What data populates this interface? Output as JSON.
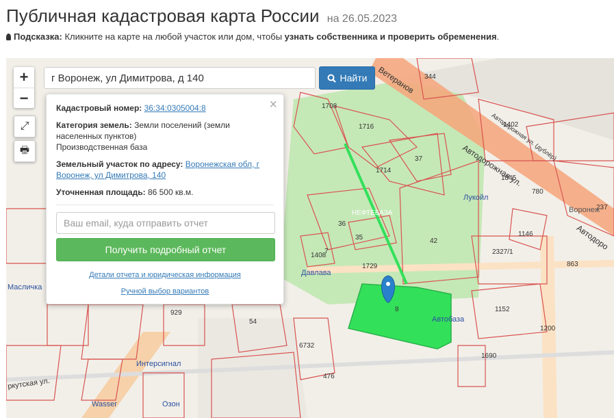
{
  "header": {
    "title": "Публичная кадастровая карта России",
    "date": "на 26.05.2023"
  },
  "hint": {
    "label": "Подсказка:",
    "text": " Кликните на карте на любой участок или дом, чтобы ",
    "bold": "узнать собственника и проверить обременения",
    "end": "."
  },
  "controls": {
    "zoom_in": "+",
    "zoom_out": "−",
    "fullscreen": "⤢",
    "print": "🖶"
  },
  "search": {
    "value": "г Воронеж, ул Димитрова, д 140",
    "button": "Найти"
  },
  "panel": {
    "close": "×",
    "cad_label": "Кадастровый номер:",
    "cad_value": "36:34:0305004:8",
    "cat_label": "Категория земель:",
    "cat_value": "Земли поселений (земли населенных пунктов)",
    "use_value": "Производственная база",
    "addr_label": "Земельный участок по адресу:",
    "addr_value": "Воронежская обл, г Воронеж, ул Димитрова, 140",
    "area_label": "Уточненная площадь:",
    "area_value": "86 500 кв.м.",
    "email_placeholder": "Ваш email, куда отправить отчет",
    "report_button": "Получить подробный отчет",
    "details_link": "Детали отчета и юридическая информация",
    "manual_link": "Ручной выбор вариантов"
  },
  "map": {
    "streets": [
      "Автодорожная ул.",
      "Автодорожная ул. (дублёр)",
      "Автодоро",
      "ркутская ул.",
      "Ветеранов"
    ],
    "parcels": [
      "344",
      "1708",
      "1716",
      "1714",
      "37",
      "36",
      "35",
      "42",
      "1729",
      "8",
      "1402",
      "1146",
      "2327/1",
      "863",
      "237",
      "1152",
      "1690",
      "929",
      "54",
      "6732",
      "476",
      "1845",
      "780",
      "1200",
      "7",
      "1408"
    ],
    "pois": [
      "Лукойл",
      "Воронеж",
      "Давлава",
      "НЕФТЕБАЗА",
      "Автобаза",
      "Интерсигнал",
      "Wasser",
      "Озон",
      "Масличка"
    ],
    "colors": {
      "parcel_border": "#d9534f",
      "selected_fill": "#33e05a",
      "green_area": "#c5e8b7",
      "road": "#f6a47a"
    }
  }
}
